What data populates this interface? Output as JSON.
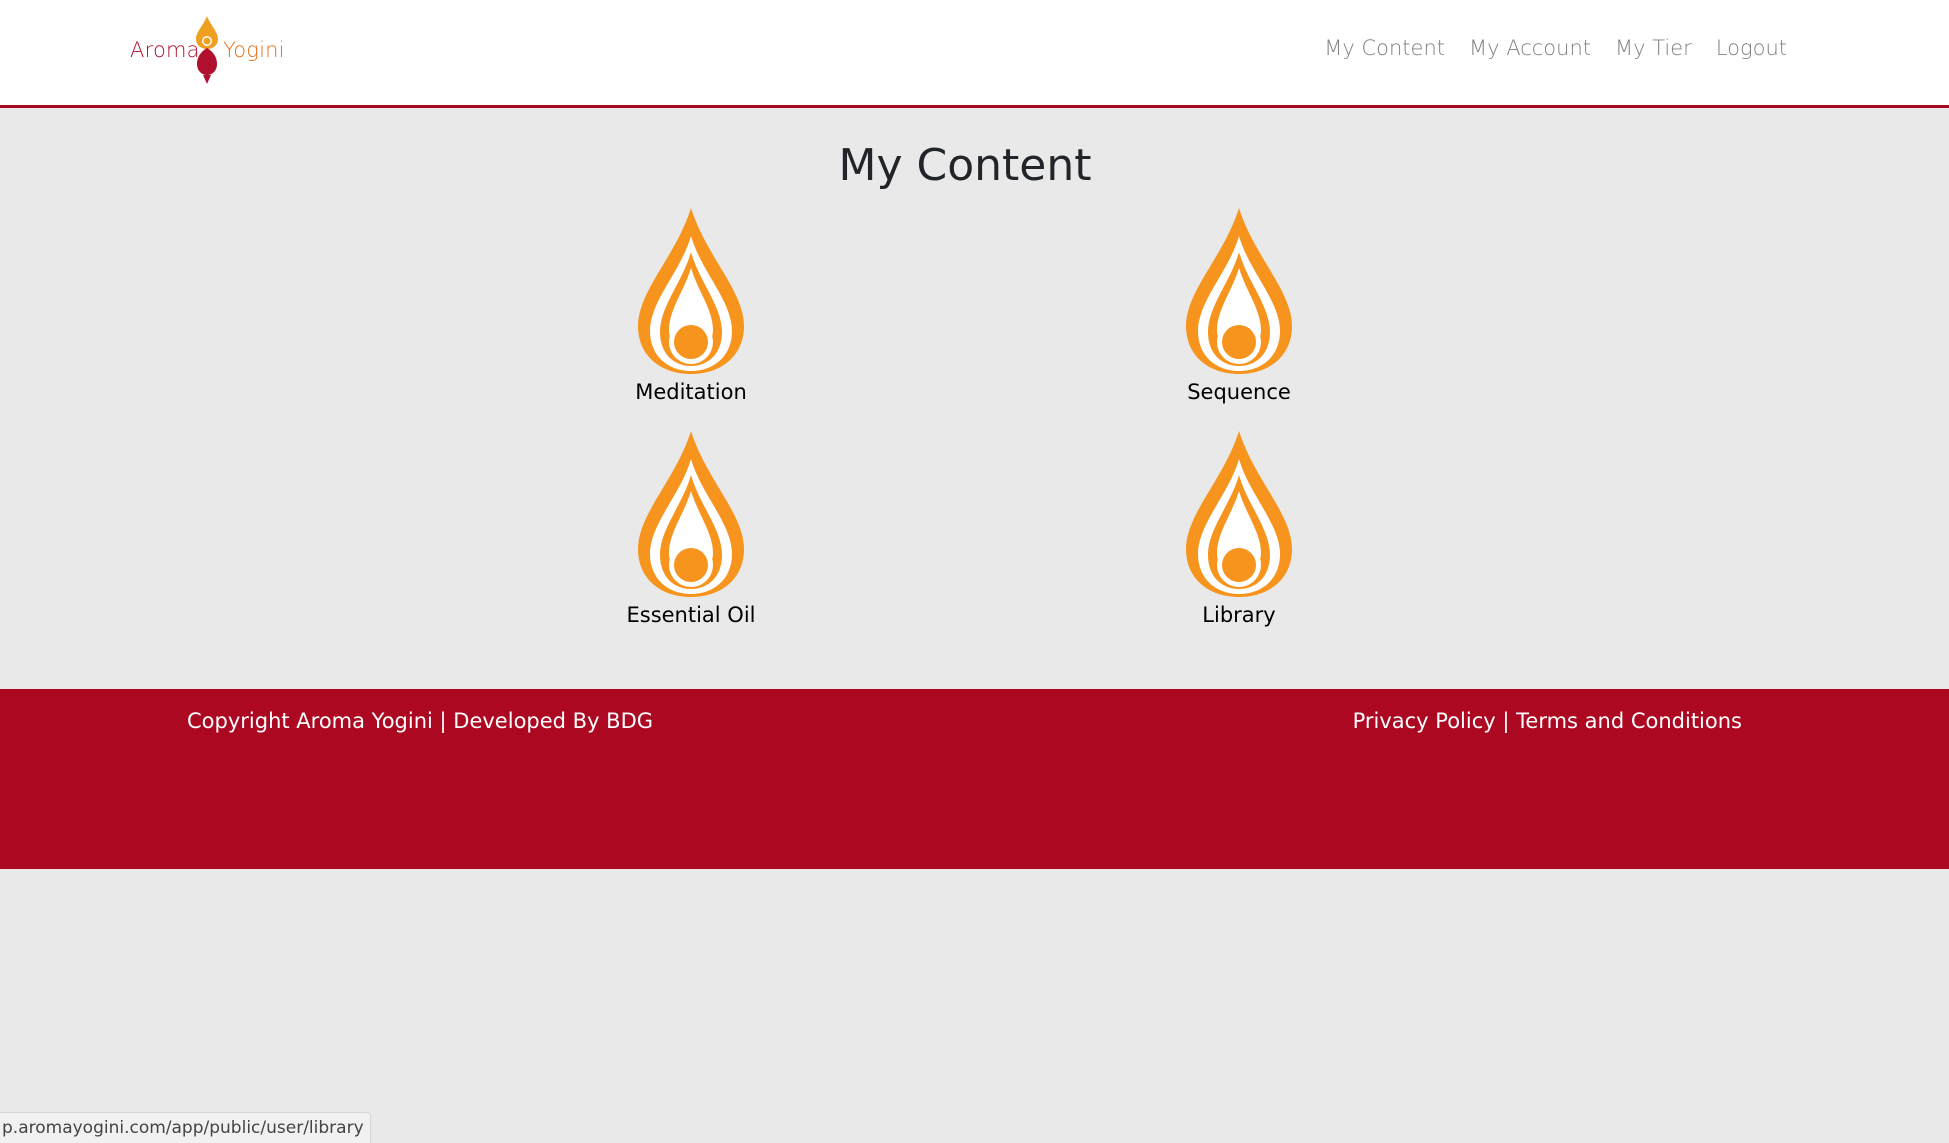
{
  "header": {
    "logo": {
      "word1": "Aroma",
      "word2": "Yogini"
    },
    "nav": [
      {
        "label": "My Content"
      },
      {
        "label": "My Account"
      },
      {
        "label": "My Tier"
      },
      {
        "label": "Logout"
      }
    ]
  },
  "main": {
    "title": "My Content",
    "tiles": [
      {
        "label": "Meditation",
        "icon": "drop-yogini-icon"
      },
      {
        "label": "Sequence",
        "icon": "drop-yogini-icon"
      },
      {
        "label": "Essential Oil",
        "icon": "drop-yogini-icon"
      },
      {
        "label": "Library",
        "icon": "drop-yogini-icon"
      }
    ]
  },
  "footer": {
    "copyright": "Copyright Aroma Yogini | Developed By BDG",
    "privacy": "Privacy Policy",
    "separator": " | ",
    "terms": "Terms and Conditions"
  },
  "statusbar": {
    "url": "p.aromayogini.com/app/public/user/library"
  },
  "colors": {
    "brand_red": "#ad0822",
    "drop_orange": "#f7941d",
    "background": "#e9e9e9"
  }
}
